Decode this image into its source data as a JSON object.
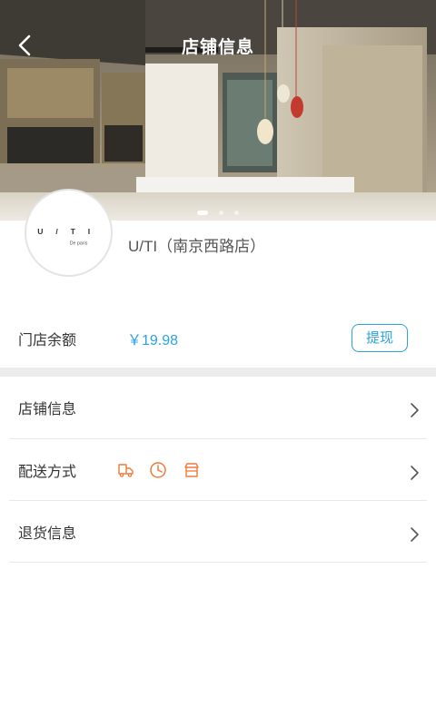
{
  "header": {
    "title": "店铺信息"
  },
  "store": {
    "name": "U/TI（南京西路店）",
    "logo_text": "U / T I",
    "logo_subtext": "De paris"
  },
  "balance": {
    "label": "门店余额",
    "value": "￥19.98",
    "withdraw_label": "提现"
  },
  "menu": [
    {
      "label": "店铺信息"
    },
    {
      "label": "配送方式",
      "icons": [
        "delivery-truck-icon",
        "clock-icon",
        "store-icon"
      ]
    },
    {
      "label": "退货信息"
    }
  ],
  "carousel": {
    "slide_count": 3,
    "active_index": 0
  },
  "colors": {
    "accent": "#2aa3e0",
    "icon_orange": "#f07a3a",
    "divider": "#e8e8e8"
  }
}
